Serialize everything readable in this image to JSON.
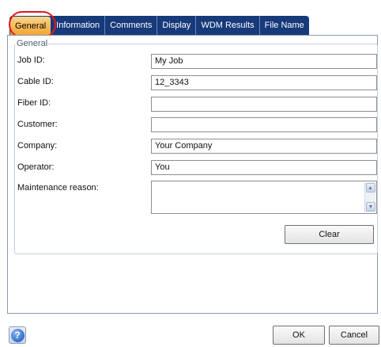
{
  "tabs": [
    {
      "label": "General",
      "active": true
    },
    {
      "label": "Information",
      "active": false
    },
    {
      "label": "Comments",
      "active": false
    },
    {
      "label": "Display",
      "active": false
    },
    {
      "label": "WDM Results",
      "active": false
    },
    {
      "label": "File Name",
      "active": false
    }
  ],
  "general": {
    "legend": "General",
    "fields": [
      {
        "label": "Job ID:",
        "value": "My Job"
      },
      {
        "label": "Cable ID:",
        "value": "12_3343"
      },
      {
        "label": "Fiber ID:",
        "value": ""
      },
      {
        "label": "Customer:",
        "value": ""
      },
      {
        "label": "Company:",
        "value": "Your Company"
      },
      {
        "label": "Operator:",
        "value": "You"
      },
      {
        "label": "Maintenance reason:",
        "value": ""
      }
    ],
    "clear_label": "Clear"
  },
  "footer": {
    "help_icon_glyph": "?",
    "ok_label": "OK",
    "cancel_label": "Cancel"
  },
  "colors": {
    "tab_bar": "#163a7a",
    "active_tab": "#f3a531",
    "highlight_ring": "#e3191f"
  }
}
